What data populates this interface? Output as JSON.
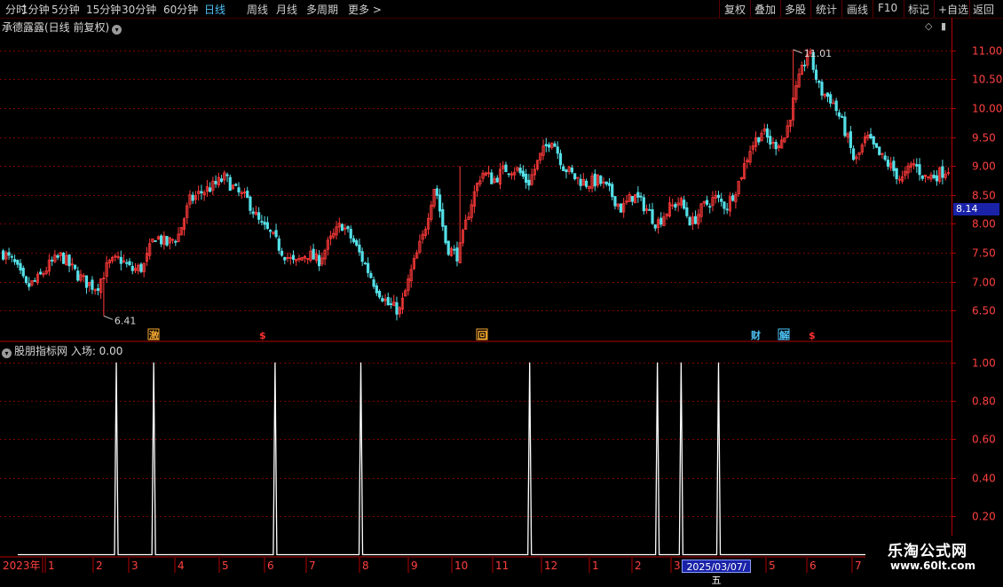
{
  "toolbar": {
    "periods": [
      "分时",
      "1分钟",
      "5分钟",
      "15分钟",
      "30分钟",
      "60分钟",
      "日线",
      "周线",
      "月线",
      "多周期",
      "更多 >"
    ],
    "active_period": "日线",
    "actions": [
      "复权",
      "叠加",
      "多股",
      "统计",
      "画线",
      "F10",
      "标记",
      "+自选",
      "返回"
    ]
  },
  "main_pane": {
    "header": "承德露露(日线 前复权)",
    "high_label": "11.01",
    "low_label": "6.41",
    "current_price": "8.14",
    "markers": [
      {
        "text": "激",
        "color": "#f7a830",
        "boxed": true
      },
      {
        "text": "$",
        "color": "#ff3030",
        "boxed": false
      },
      {
        "text": "回",
        "color": "#f7a830",
        "boxed": true
      },
      {
        "text": "财",
        "color": "#4ec3f7",
        "boxed": false
      },
      {
        "text": "解",
        "color": "#4ec3f7",
        "boxed": true
      },
      {
        "text": "$",
        "color": "#ff3030",
        "boxed": false
      }
    ]
  },
  "sub_pane": {
    "header": "股朋指标网 入场: 0.00"
  },
  "date_axis": {
    "year_label": "2023年",
    "month_labels": [
      "1",
      "2",
      "3",
      "4",
      "5",
      "6",
      "7",
      "8",
      "9",
      "10",
      "11",
      "12",
      "1",
      "2",
      "3",
      "5",
      "6",
      "7"
    ],
    "cursor_date": "2025/03/07/五"
  },
  "watermark": {
    "title": "乐淘公式网",
    "url": "www.60lt.com"
  },
  "colors": {
    "up": "#ff3a3a",
    "down": "#55e0e8",
    "axis": "#b00000",
    "grid": "#7a0000",
    "signal": "#ffffff"
  },
  "chart_data": [
    {
      "type": "candlestick",
      "title": "承德露露(日线 前复权)",
      "ylim": [
        6.2,
        11.3
      ],
      "y_ticks": [
        6.5,
        7.0,
        7.5,
        8.0,
        8.5,
        9.0,
        9.5,
        10.0,
        10.5,
        11.0
      ],
      "grid": true,
      "high": 11.01,
      "low": 6.41,
      "last": 8.14,
      "trend_closes": [
        7.5,
        7.3,
        6.9,
        7.05,
        7.3,
        7.45,
        7.2,
        7.0,
        6.9,
        7.3,
        7.4,
        7.2,
        7.25,
        7.8,
        7.65,
        7.8,
        8.4,
        8.55,
        8.65,
        8.8,
        8.55,
        8.4,
        8.0,
        7.8,
        7.5,
        7.3,
        7.5,
        7.35,
        7.7,
        8.0,
        7.7,
        7.3,
        6.9,
        6.6,
        6.5,
        7.2,
        7.8,
        8.7,
        7.6,
        7.45,
        8.3,
        8.9,
        8.75,
        8.95,
        8.95,
        8.7,
        9.15,
        9.5,
        9.0,
        8.8,
        8.7,
        8.75,
        8.55,
        8.25,
        8.5,
        8.3,
        8.0,
        8.25,
        8.4,
        8.0,
        8.3,
        8.45,
        8.3,
        8.7,
        9.3,
        9.6,
        9.35,
        9.5,
        10.35,
        11.0,
        10.3,
        10.15,
        9.7,
        9.05,
        9.5,
        9.2,
        9.0,
        8.75,
        9.05,
        8.8,
        8.85,
        8.95
      ]
    },
    {
      "type": "line",
      "name": "入场",
      "ylim": [
        0,
        1.05
      ],
      "y_ticks": [
        0.2,
        0.4,
        0.6,
        0.8,
        1.0
      ],
      "value": 0.0,
      "signal_x_fraction": [
        0.108,
        0.149,
        0.282,
        0.376,
        0.561,
        0.701,
        0.727,
        0.768
      ]
    }
  ]
}
